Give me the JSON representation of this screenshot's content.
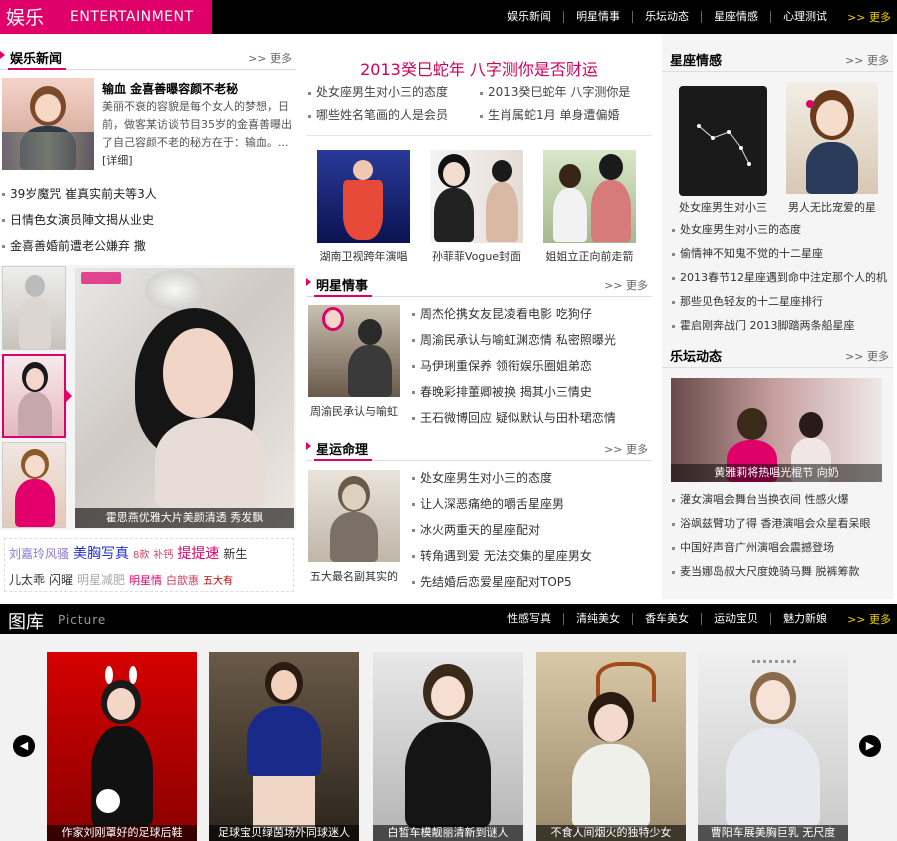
{
  "header": {
    "logo_cn": "娱乐",
    "logo_en": "ENTERTAINMENT",
    "nav": [
      "娱乐新闻",
      "明星情事",
      "乐坛动态",
      "星座情感",
      "心理测试"
    ],
    "more": "更多"
  },
  "ent_news": {
    "title": "娱乐新闻",
    "more": "更多",
    "featured_title": "输血 金喜善曝容颜不老秘",
    "featured_desc": "美丽不衰的容貌是每个女人的梦想，日前，做客某访谈节目35岁的金喜善曝出了自己容颜不老的秘方在于：输血。...",
    "detail": "[详细]",
    "items": [
      "39岁魔咒 崔真实前夫等3人",
      "日情色女演员陣文揭从业史",
      "金喜善婚前遭老公嫌弃 撒"
    ],
    "slide_caption": "霍思燕优雅大片美颜清透 秀发飘",
    "tags": [
      {
        "text": "刘嘉玲风骚",
        "color": "#8a7ad0"
      },
      {
        "text": "美胸写真",
        "color": "#2233cc"
      },
      {
        "text": "8款",
        "color": "#cc4466"
      },
      {
        "text": "补钙",
        "color": "#cc4466"
      },
      {
        "text": "提提速",
        "color": "#e0006a"
      },
      {
        "text": "新生",
        "color": "#333333"
      },
      {
        "text": "儿太乖",
        "color": "#333333"
      },
      {
        "text": "闪曜",
        "color": "#333333"
      },
      {
        "text": "明星减肥",
        "color": "#aaaaaa"
      },
      {
        "text": "明星情",
        "color": "#e0006a"
      },
      {
        "text": "白歆惠",
        "color": "#cc4466"
      },
      {
        "text": "五大有",
        "color": "#cc0000"
      }
    ]
  },
  "center_top": {
    "headline": "2013癸巳蛇年 八字测你是否财运",
    "links": [
      "处女座男生对小三的态度",
      "2013癸巳蛇年 八字测你是",
      "哪些姓名笔画的人是会员",
      "生肖属蛇1月 单身遭偏婚"
    ],
    "photos": [
      "湖南卫视跨年演唱",
      "孙菲菲Vogue封面",
      "姐姐立正向前走箭"
    ]
  },
  "star_affairs": {
    "title": "明星情事",
    "more": "更多",
    "photo_caption": "周渝民承认与喻虹",
    "items": [
      "周杰伦携女友昆凌看电影 吃狗仔",
      "周渝民承认与喻虹渊恋情 私密照曝光",
      "马伊琍重保养 领衔娱乐圈姐弟恋",
      "春晚彩排董卿被换 揭其小三情史",
      "王石微博回应 疑似默认与田朴珺恋情"
    ]
  },
  "fortune": {
    "title": "星运命理",
    "more": "更多",
    "photo_caption": "五大最名副其实的",
    "items": [
      "处女座男生对小三的态度",
      "让人深恶痛绝的嚼舌星座男",
      "冰火两重天的星座配对",
      "转角遇到爱 无法交集的星座男女",
      "先结婚后恋爱星座配对TOP5"
    ]
  },
  "zodiac": {
    "title": "星座情感",
    "more": "更多",
    "photos": [
      "处女座男生对小三",
      "男人无比宠爱的星"
    ],
    "items": [
      "处女座男生对小三的态度",
      "偷情神不知鬼不觉的十二星座",
      "2013春节12星座遇到命中注定那个人的机",
      "那些见色轻友的十二星座排行",
      "霍启刚奔战门 2013脚踏两条船星座"
    ]
  },
  "music": {
    "title": "乐坛动态",
    "more": "更多",
    "photo_caption": "黄雅莉将热唱光棍节 向奶",
    "items": [
      "灌女演唱会舞台当换衣间 性感火爆",
      "浴飒兹臂功了得 香港演唱会众星看呆眼",
      "中国好声音广州演唱会震撼登场",
      "麦当娜岛叔大尺度娩骑马舞 脱裤筹款"
    ]
  },
  "gallery": {
    "title_cn": "图库",
    "title_en": "Picture",
    "nav": [
      "性感写真",
      "清纯美女",
      "香车美女",
      "运动宝贝",
      "魅力新娘"
    ],
    "more": "更多",
    "cards": [
      "作家刘刚罩好的足球后鞋",
      "足球宝贝绿茵场外同球迷人",
      "白皙车模靓丽清新到谜人",
      "不食人间烟火的独特少女",
      "曹阳车展美胸巨乳 无尺度"
    ],
    "prev": "◀",
    "next": "▶"
  },
  "colors": {
    "accent": "#e0006a",
    "black_bar": "#000000",
    "gallery_bg": "#f2f2f2"
  }
}
